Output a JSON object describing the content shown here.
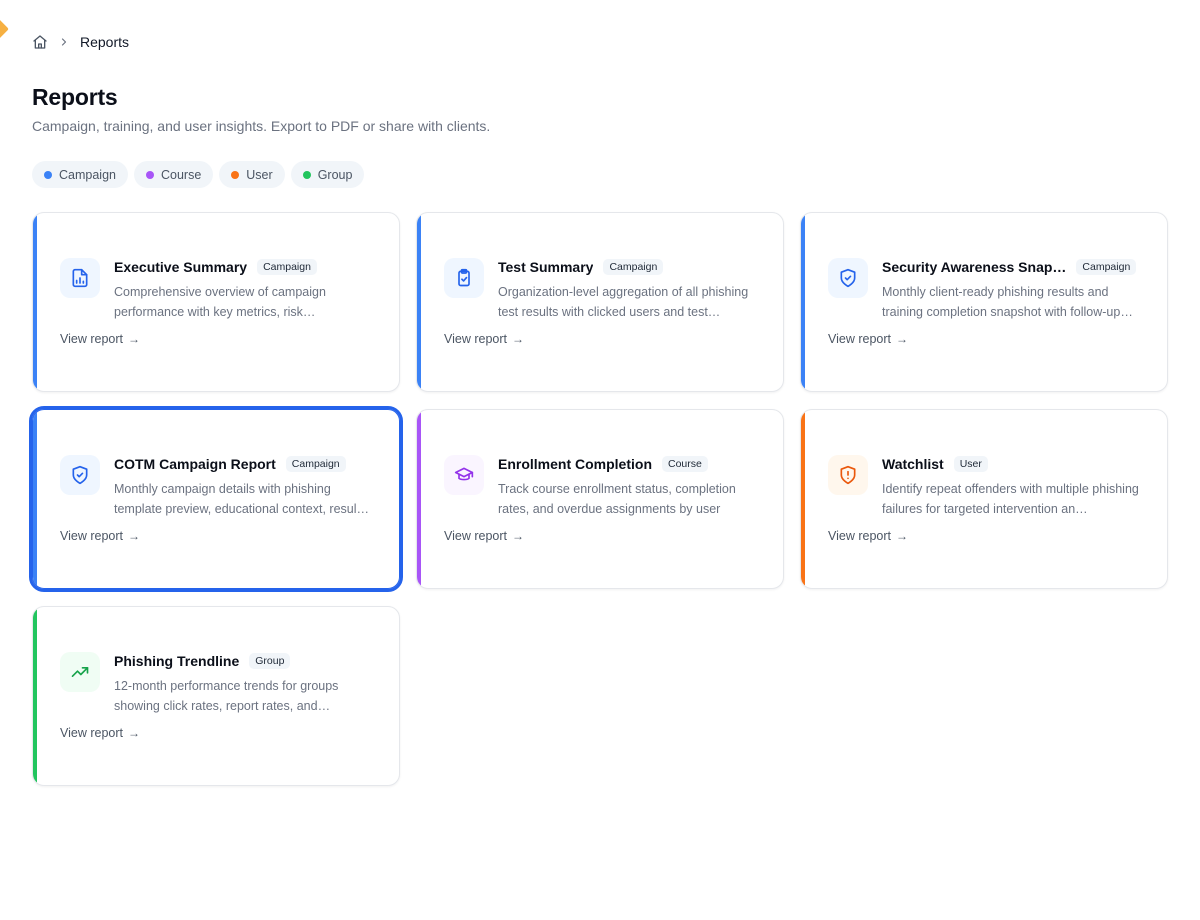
{
  "breadcrumb": {
    "current": "Reports"
  },
  "header": {
    "title": "Reports",
    "subtitle": "Campaign, training, and user insights. Export to PDF or share with clients."
  },
  "filters": [
    {
      "label": "Campaign",
      "color": "#3b82f6"
    },
    {
      "label": "Course",
      "color": "#a855f7"
    },
    {
      "label": "User",
      "color": "#f97316"
    },
    {
      "label": "Group",
      "color": "#22c55e"
    }
  ],
  "cards": [
    {
      "title": "Executive Summary",
      "badge": "Campaign",
      "description": "Comprehensive overview of campaign performance with key metrics, risk…",
      "link": "View report",
      "accent": "#3b82f6",
      "icon": "report-chart-icon",
      "icon_color": "#2563eb",
      "icon_bg": "#eff6ff",
      "selected": false
    },
    {
      "title": "Test Summary",
      "badge": "Campaign",
      "description": "Organization-level aggregation of all phishing test results with clicked users and test…",
      "link": "View report",
      "accent": "#3b82f6",
      "icon": "clipboard-check-icon",
      "icon_color": "#2563eb",
      "icon_bg": "#eff6ff",
      "selected": false
    },
    {
      "title": "Security Awareness Snap…",
      "badge": "Campaign",
      "description": "Monthly client-ready phishing results and training completion snapshot with follow-up…",
      "link": "View report",
      "accent": "#3b82f6",
      "icon": "shield-check-icon",
      "icon_color": "#2563eb",
      "icon_bg": "#eff6ff",
      "selected": false
    },
    {
      "title": "COTM Campaign Report",
      "badge": "Campaign",
      "description": "Monthly campaign details with phishing template preview, educational context, resul…",
      "link": "View report",
      "accent": "#3b82f6",
      "icon": "shield-check-icon",
      "icon_color": "#2563eb",
      "icon_bg": "#eff6ff",
      "selected": true
    },
    {
      "title": "Enrollment Completion",
      "badge": "Course",
      "description": "Track course enrollment status, completion rates, and overdue assignments by user",
      "link": "View report",
      "accent": "#a855f7",
      "icon": "graduation-cap-icon",
      "icon_color": "#9333ea",
      "icon_bg": "#faf5ff",
      "selected": false
    },
    {
      "title": "Watchlist",
      "badge": "User",
      "description": "Identify repeat offenders with multiple phishing failures for targeted intervention an…",
      "link": "View report",
      "accent": "#f97316",
      "icon": "alert-shield-icon",
      "icon_color": "#ea580c",
      "icon_bg": "#fff7ed",
      "selected": false
    },
    {
      "title": "Phishing Trendline",
      "badge": "Group",
      "description": "12-month performance trends for groups showing click rates, report rates, and…",
      "link": "View report",
      "accent": "#22c55e",
      "icon": "trending-up-icon",
      "icon_color": "#16a34a",
      "icon_bg": "#f0fdf4",
      "selected": false
    }
  ]
}
